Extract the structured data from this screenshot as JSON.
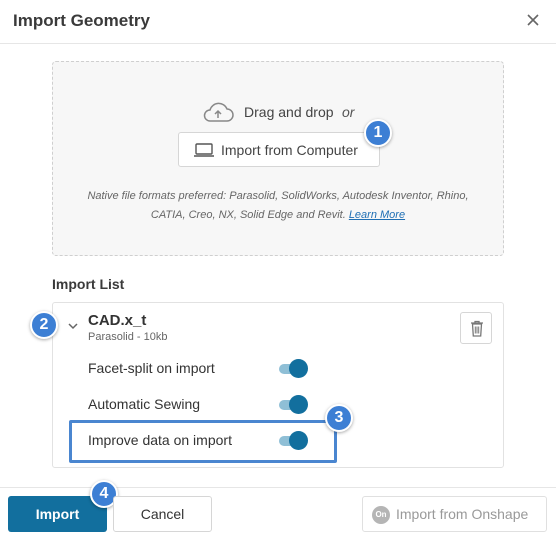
{
  "dialog": {
    "title": "Import Geometry",
    "close_icon": "close-icon"
  },
  "dropzone": {
    "drag_text": "Drag and drop",
    "or_text": "or",
    "upload_icon": "cloud-upload-icon",
    "import_computer_label": "Import from Computer",
    "import_computer_icon": "laptop-icon",
    "native_formats_text": "Native file formats preferred: Parasolid, SolidWorks, Autodesk Inventor, Rhino, CATIA, Creo, NX, Solid Edge and Revit.",
    "learn_more_label": "Learn More"
  },
  "import_list": {
    "title": "Import List",
    "files": [
      {
        "name": "CAD.x_t",
        "meta": "Parasolid - 10kb",
        "expanded": true,
        "options": [
          {
            "label": "Facet-split on import",
            "enabled": true
          },
          {
            "label": "Automatic Sewing",
            "enabled": true
          },
          {
            "label": "Improve data on import",
            "enabled": true
          }
        ]
      }
    ]
  },
  "annotations": [
    "1",
    "2",
    "3",
    "4"
  ],
  "footer": {
    "import_label": "Import",
    "cancel_label": "Cancel",
    "onshape_label": "Import from Onshape",
    "onshape_icon_text": "On"
  },
  "colors": {
    "primary": "#126f9e",
    "toggle_track": "#8fbfd6",
    "toggle_knob": "#126f9e",
    "annotation_badge": "#3d7fd4",
    "link": "#1f6fb4"
  }
}
